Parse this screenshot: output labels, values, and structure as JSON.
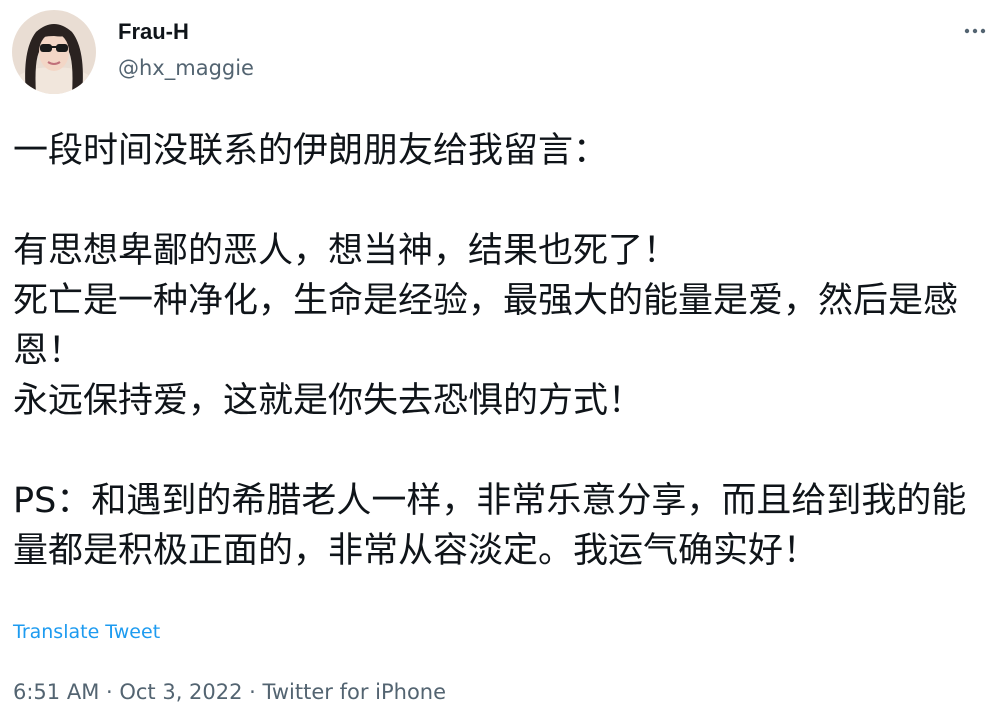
{
  "author": {
    "display_name": "Frau-H",
    "handle": "@hx_maggie",
    "avatar_icon": "user-avatar-photo"
  },
  "more_icon": "more-horizontal-icon",
  "tweet": {
    "lines": [
      "一段时间没联系的伊朗朋友给我留言：",
      "",
      "有思想卑鄙的恶人，想当神，结果也死了！",
      "死亡是一种净化，生命是经验，最强大的能量是爱，然后是感恩！",
      "永远保持爱，这就是你失去恐惧的方式！",
      "",
      "PS：和遇到的希腊老人一样，非常乐意分享，而且给到我的能量都是积极正面的，非常从容淡定。我运气确实好！"
    ]
  },
  "translate_label": "Translate Tweet",
  "meta": {
    "time": "6:51 AM",
    "separator": " · ",
    "date": "Oct 3, 2022",
    "source": "Twitter for iPhone"
  },
  "colors": {
    "text": "#0f1419",
    "secondary": "#536471",
    "link": "#1d9bf0"
  }
}
